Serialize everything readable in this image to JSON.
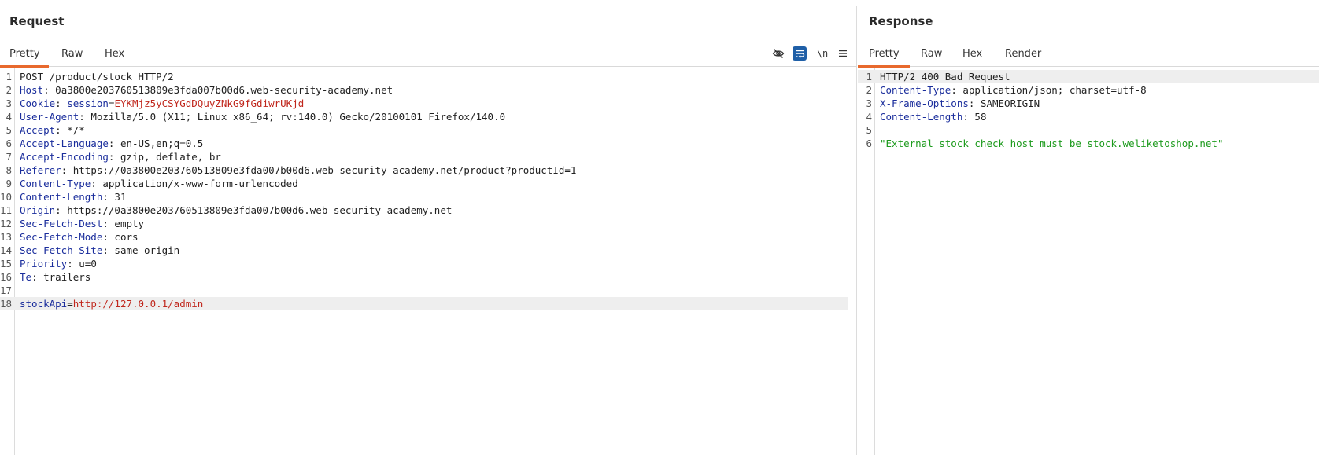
{
  "request": {
    "title": "Request",
    "tabs": [
      "Pretty",
      "Raw",
      "Hex"
    ],
    "active_tab": "Pretty",
    "toolbar": {
      "newline_label": "\\n",
      "icons": [
        "hide-eye-icon",
        "wrap-lines-icon",
        "newline-icon",
        "menu-icon"
      ]
    },
    "lines": [
      {
        "n": "1",
        "plain": "POST /product/stock HTTP/2"
      },
      {
        "n": "2",
        "k": "Host",
        "v": " 0a3800e203760513809e3fda007b00d6.web-security-academy.net"
      },
      {
        "n": "3",
        "k": "Cookie",
        "v": " ",
        "ck": "session",
        "eq": "=",
        "cv": "EYKMjz5yCSYGdDQuyZNkG9fGdiwrUKjd"
      },
      {
        "n": "4",
        "k": "User-Agent",
        "v": " Mozilla/5.0 (X11; Linux x86_64; rv:140.0) Gecko/20100101 Firefox/140.0"
      },
      {
        "n": "5",
        "k": "Accept",
        "v": " */*"
      },
      {
        "n": "6",
        "k": "Accept-Language",
        "v": " en-US,en;q=0.5"
      },
      {
        "n": "7",
        "k": "Accept-Encoding",
        "v": " gzip, deflate, br"
      },
      {
        "n": "8",
        "k": "Referer",
        "v": " https://0a3800e203760513809e3fda007b00d6.web-security-academy.net/product?productId=1"
      },
      {
        "n": "9",
        "k": "Content-Type",
        "v": " application/x-www-form-urlencoded"
      },
      {
        "n": "10",
        "k": "Content-Length",
        "v": " 31"
      },
      {
        "n": "11",
        "k": "Origin",
        "v": " https://0a3800e203760513809e3fda007b00d6.web-security-academy.net"
      },
      {
        "n": "12",
        "k": "Sec-Fetch-Dest",
        "v": " empty"
      },
      {
        "n": "13",
        "k": "Sec-Fetch-Mode",
        "v": " cors"
      },
      {
        "n": "14",
        "k": "Sec-Fetch-Site",
        "v": " same-origin"
      },
      {
        "n": "15",
        "k": "Priority",
        "v": " u=0"
      },
      {
        "n": "16",
        "k": "Te",
        "v": " trailers"
      },
      {
        "n": "17",
        "plain": ""
      },
      {
        "n": "18",
        "ck": "stockApi",
        "eq": "=",
        "cv": "http://127.0.0.1/admin",
        "hl": true
      }
    ]
  },
  "response": {
    "title": "Response",
    "tabs": [
      "Pretty",
      "Raw",
      "Hex",
      "Render"
    ],
    "active_tab": "Pretty",
    "lines": [
      {
        "n": "1",
        "plain": "HTTP/2 400 Bad Request",
        "hl": true
      },
      {
        "n": "2",
        "k": "Content-Type",
        "v": " application/json; charset=utf-8"
      },
      {
        "n": "3",
        "k": "X-Frame-Options",
        "v": " SAMEORIGIN"
      },
      {
        "n": "4",
        "k": "Content-Length",
        "v": " 58"
      },
      {
        "n": "5",
        "plain": ""
      },
      {
        "n": "6",
        "str": "\"External stock check host must be stock.weliketoshop.net\""
      }
    ]
  }
}
